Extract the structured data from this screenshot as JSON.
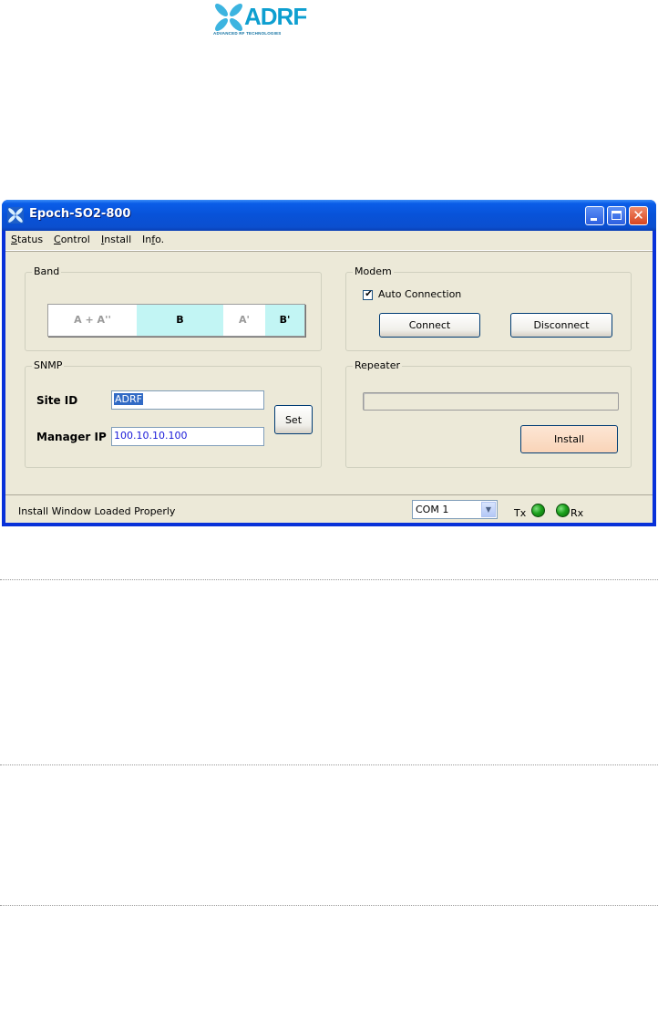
{
  "logo": {
    "text": "ADRF",
    "subtitle": "ADVANCED RF TECHNOLOGIES",
    "color": "#0e9fd0"
  },
  "window": {
    "title": "Epoch-SO2-800",
    "close_glyph": "✕"
  },
  "menu": [
    {
      "label": "Status",
      "accel": "S",
      "rest": "tatus"
    },
    {
      "label": "Control",
      "accel": "C",
      "rest": "ontrol"
    },
    {
      "label": "Install",
      "accel": "I",
      "rest": "nstall"
    },
    {
      "label": "Info.",
      "pre": "In",
      "accel": "f",
      "rest": "o."
    }
  ],
  "band": {
    "title": "Band",
    "segments": [
      {
        "label": "A + A''",
        "bg": "#ffffff",
        "color": "#9a9a9a"
      },
      {
        "label": "B",
        "bg": "#c2f5f4",
        "color": "#000000"
      },
      {
        "label": "A'",
        "bg": "#ffffff",
        "color": "#9a9a9a"
      },
      {
        "label": "B'",
        "bg": "#c2f5f4",
        "color": "#000000"
      }
    ]
  },
  "modem": {
    "title": "Modem",
    "auto_connection_label": "Auto Connection",
    "auto_connection_checked": true,
    "check_glyph": "✔",
    "connect_label": "Connect",
    "disconnect_label": "Disconnect"
  },
  "snmp": {
    "title": "SNMP",
    "site_id_label": "Site ID",
    "site_id_value": "ADRF",
    "manager_ip_label": "Manager IP",
    "manager_ip_value": "100.10.10.100",
    "set_label": "Set"
  },
  "repeater": {
    "title": "Repeater",
    "progress": 0,
    "install_label": "Install"
  },
  "status_bar": {
    "message": "Install Window Loaded Properly",
    "com_port": "COM 1",
    "tx_label": "Tx",
    "rx_label": "Rx"
  }
}
